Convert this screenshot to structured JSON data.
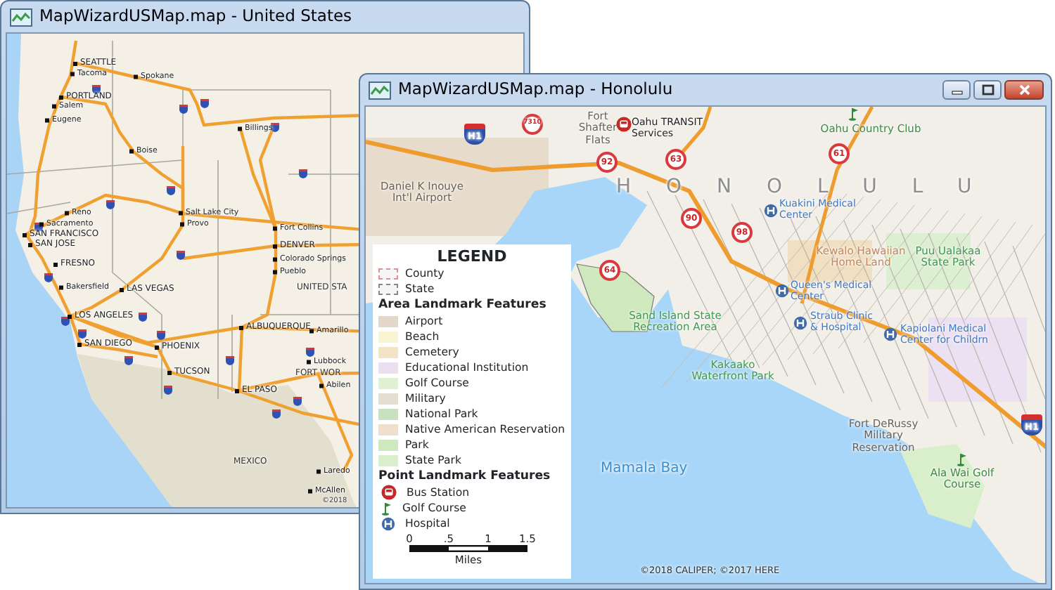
{
  "windows": [
    {
      "title": "MapWizardUSMap.map - United States",
      "controls": false,
      "map": {
        "labels": [
          {
            "text": "SEATTLE",
            "kind": "city"
          },
          {
            "text": "Tacoma",
            "kind": "town"
          },
          {
            "text": "Spokane",
            "kind": "town"
          },
          {
            "text": "PORTLAND",
            "kind": "city"
          },
          {
            "text": "Salem",
            "kind": "town"
          },
          {
            "text": "Eugene",
            "kind": "town"
          },
          {
            "text": "Billings",
            "kind": "town"
          },
          {
            "text": "Boise",
            "kind": "town"
          },
          {
            "text": "Reno",
            "kind": "town"
          },
          {
            "text": "Sacramento",
            "kind": "town"
          },
          {
            "text": "Salt Lake City",
            "kind": "town"
          },
          {
            "text": "Provo",
            "kind": "town"
          },
          {
            "text": "SAN FRANCISCO",
            "kind": "city"
          },
          {
            "text": "SAN JOSE",
            "kind": "city"
          },
          {
            "text": "Fort Collins",
            "kind": "town"
          },
          {
            "text": "DENVER",
            "kind": "city"
          },
          {
            "text": "Colorado Springs",
            "kind": "town"
          },
          {
            "text": "Pueblo",
            "kind": "town"
          },
          {
            "text": "UNITED STA",
            "kind": "region"
          },
          {
            "text": "FRESNO",
            "kind": "city"
          },
          {
            "text": "Bakersfield",
            "kind": "town"
          },
          {
            "text": "LAS VEGAS",
            "kind": "city"
          },
          {
            "text": "LOS ANGELES",
            "kind": "city"
          },
          {
            "text": "ALBUQUERQUE",
            "kind": "city"
          },
          {
            "text": "Amarillo",
            "kind": "town"
          },
          {
            "text": "SAN DIEGO",
            "kind": "city"
          },
          {
            "text": "PHOENIX",
            "kind": "city"
          },
          {
            "text": "Lubbock",
            "kind": "town"
          },
          {
            "text": "TUCSON",
            "kind": "city"
          },
          {
            "text": "FORT WOR",
            "kind": "region"
          },
          {
            "text": "Abilen",
            "kind": "town"
          },
          {
            "text": "EL PASO",
            "kind": "city"
          },
          {
            "text": "MEXICO",
            "kind": "region"
          },
          {
            "text": "Laredo",
            "kind": "town"
          },
          {
            "text": "McAllen",
            "kind": "town"
          },
          {
            "text": "©2018",
            "kind": "credit"
          }
        ]
      }
    },
    {
      "title": "MapWizardUSMap.map - Honolulu",
      "controls": true,
      "map": {
        "labels": [
          {
            "text": "Fort Shafter Flats",
            "kind": "place"
          },
          {
            "text": "Oahu TRANSIT Services",
            "kind": "bus"
          },
          {
            "text": "Oahu Country Club",
            "kind": "golf"
          },
          {
            "text": "Daniel K Inouye Int'l Airport",
            "kind": "place"
          },
          {
            "text": "HONOLULU",
            "kind": "district"
          },
          {
            "text": "Kuakini Medical Center",
            "kind": "hospital"
          },
          {
            "text": "Kewalo Hawaiian Home Land",
            "kind": "homeland"
          },
          {
            "text": "Puu Ualakaa State Park",
            "kind": "park"
          },
          {
            "text": "Queen's Medical Center",
            "kind": "hospital"
          },
          {
            "text": "Sand Island State Recreation Area",
            "kind": "park"
          },
          {
            "text": "Straub Clinic & Hospital",
            "kind": "hospital"
          },
          {
            "text": "Kapiolani Medical Center for Childrn",
            "kind": "hospital"
          },
          {
            "text": "Kakaako Waterfront Park",
            "kind": "park"
          },
          {
            "text": "Fort DeRussy Military Reservation",
            "kind": "place"
          },
          {
            "text": "Ala Wai Golf Course",
            "kind": "golf"
          },
          {
            "text": "Mamala Bay",
            "kind": "water"
          },
          {
            "text": "©2018 CALIPER; ©2017 HERE",
            "kind": "credit"
          }
        ],
        "route_shields": [
          {
            "text": "H1",
            "kind": "interstate"
          },
          {
            "text": "7310",
            "kind": "state"
          },
          {
            "text": "92",
            "kind": "state"
          },
          {
            "text": "63",
            "kind": "state"
          },
          {
            "text": "61",
            "kind": "state"
          },
          {
            "text": "90",
            "kind": "state"
          },
          {
            "text": "98",
            "kind": "state"
          },
          {
            "text": "64",
            "kind": "state"
          },
          {
            "text": "H1",
            "kind": "interstate"
          }
        ],
        "legend": {
          "title": "LEGEND",
          "entries": [
            {
              "kind": "boundary",
              "label": "County",
              "color": "#e08f9a"
            },
            {
              "kind": "boundary",
              "label": "State",
              "color": "#8a8a8a"
            },
            {
              "kind": "heading",
              "label": "Area Landmark Features"
            },
            {
              "kind": "area",
              "label": "Airport",
              "color": "#e3d7cb"
            },
            {
              "kind": "area",
              "label": "Beach",
              "color": "#f8f3d0"
            },
            {
              "kind": "area",
              "label": "Cemetery",
              "color": "#f3e4c6"
            },
            {
              "kind": "area",
              "label": "Educational Institution",
              "color": "#eadff0"
            },
            {
              "kind": "area",
              "label": "Golf Course",
              "color": "#dff0d3"
            },
            {
              "kind": "area",
              "label": "Military",
              "color": "#e5dfd3"
            },
            {
              "kind": "area",
              "label": "National Park",
              "color": "#c8e2c1"
            },
            {
              "kind": "area",
              "label": "Native American Reservation",
              "color": "#eee0cc"
            },
            {
              "kind": "area",
              "label": "Park",
              "color": "#cfe8bd"
            },
            {
              "kind": "area",
              "label": "State Park",
              "color": "#d9efcc"
            },
            {
              "kind": "heading",
              "label": "Point Landmark Features"
            },
            {
              "kind": "bus",
              "label": "Bus Station"
            },
            {
              "kind": "golf",
              "label": "Golf Course"
            },
            {
              "kind": "hospital",
              "label": "Hospital"
            }
          ],
          "scale": {
            "ticks": [
              "0",
              ".5",
              "1",
              "1.5"
            ],
            "unit": "Miles"
          }
        }
      }
    }
  ]
}
